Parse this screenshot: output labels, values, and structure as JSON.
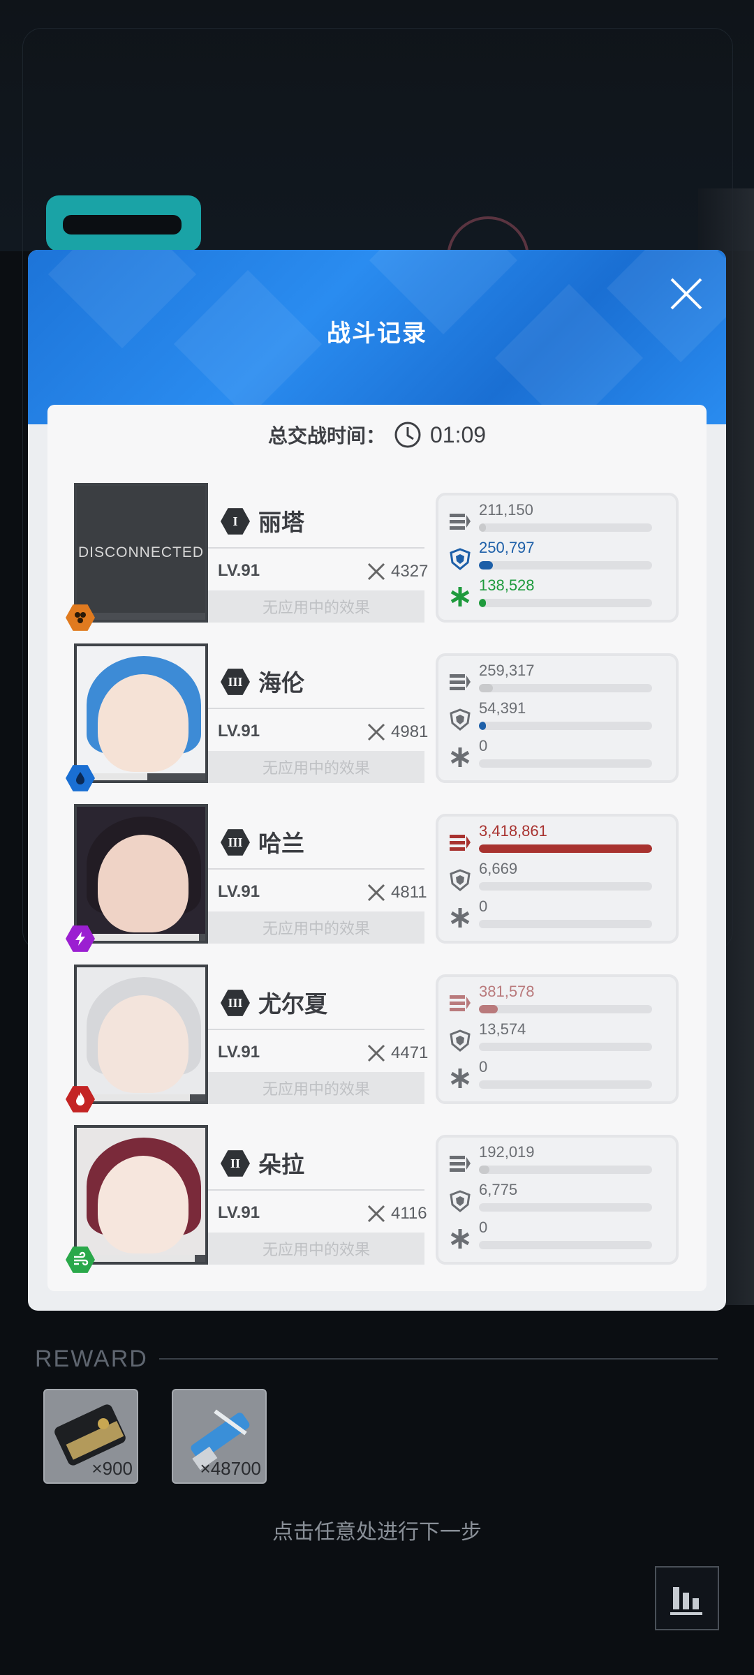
{
  "panel": {
    "title": "战斗记录",
    "time_label": "总交战时间：",
    "time_value": "01:09"
  },
  "characters": [
    {
      "name": "丽塔",
      "rank": "I",
      "level": "LV.91",
      "power": "4327",
      "effect": "无应用中的效果",
      "portrait_status": "DISCONNECTED",
      "element_icon": "iron-element-icon",
      "element_color": "#e07a1f",
      "damage": "211,150",
      "damage_ratio": 0.04,
      "shield": "250,797",
      "shield_ratio": 0.08,
      "heal": "138,528",
      "heal_ratio": 0.04
    },
    {
      "name": "海伦",
      "rank": "III",
      "level": "LV.91",
      "power": "4981",
      "effect": "无应用中的效果",
      "element_icon": "water-element-icon",
      "element_color": "#1a6fd3",
      "damage": "259,317",
      "damage_ratio": 0.08,
      "shield": "54,391",
      "shield_ratio": 0.01,
      "heal": "0",
      "heal_ratio": 0
    },
    {
      "name": "哈兰",
      "rank": "III",
      "level": "LV.91",
      "power": "4811",
      "effect": "无应用中的效果",
      "element_icon": "electric-element-icon",
      "element_color": "#9b1fd1",
      "damage": "3,418,861",
      "damage_ratio": 1.0,
      "shield": "6,669",
      "shield_ratio": 0.0,
      "heal": "0",
      "heal_ratio": 0
    },
    {
      "name": "尤尔夏",
      "rank": "III",
      "level": "LV.91",
      "power": "4471",
      "effect": "无应用中的效果",
      "element_icon": "fire-element-icon",
      "element_color": "#c42424",
      "damage": "381,578",
      "damage_ratio": 0.11,
      "shield": "13,574",
      "shield_ratio": 0.0,
      "heal": "0",
      "heal_ratio": 0
    },
    {
      "name": "朵拉",
      "rank": "II",
      "level": "LV.91",
      "power": "4116",
      "effect": "无应用中的效果",
      "element_icon": "wind-element-icon",
      "element_color": "#2aa84a",
      "damage": "192,019",
      "damage_ratio": 0.06,
      "shield": "6,775",
      "shield_ratio": 0.0,
      "heal": "0",
      "heal_ratio": 0
    }
  ],
  "reward": {
    "label": "REWARD",
    "items": [
      {
        "icon": "card-item-icon",
        "qty": "×900"
      },
      {
        "icon": "usb-item-icon",
        "qty": "×48700"
      }
    ]
  },
  "hint": "点击任意处进行下一步",
  "colors": {
    "damage_normal": "#c9cacc",
    "damage_top": "#a8322f",
    "damage_second": "#b97a7c",
    "shield": "#1d5fa8",
    "heal": "#1e9a3c"
  }
}
